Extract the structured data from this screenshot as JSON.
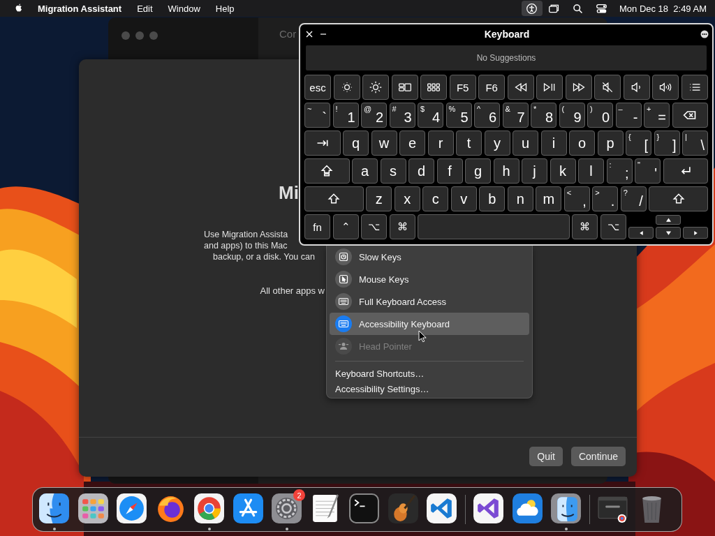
{
  "menu_bar": {
    "app": "Migration Assistant",
    "menus": [
      "Edit",
      "Window",
      "Help"
    ],
    "clock": "Mon Dec 18  2:49 AM"
  },
  "background_window": {
    "title": "Cor"
  },
  "migration_window": {
    "title": "Mi",
    "lines": [
      "Use Migration Assista",
      "and apps) to this Mac",
      "backup, or a disk. You can"
    ],
    "note": "All other apps w",
    "buttons": [
      "Quit",
      "Continue"
    ]
  },
  "keyboard_window": {
    "title": "Keyboard",
    "suggestion": "No Suggestions",
    "rows": [
      {
        "keys": [
          {
            "kind": "char",
            "label": "esc"
          },
          {
            "kind": "icon"
          },
          {
            "kind": "icon"
          },
          {
            "kind": "icon"
          },
          {
            "kind": "icon"
          },
          {
            "kind": "char",
            "label": "F5"
          },
          {
            "kind": "char",
            "label": "F6"
          },
          {
            "kind": "icon"
          },
          {
            "kind": "icon"
          },
          {
            "kind": "icon"
          },
          {
            "kind": "icon"
          },
          {
            "kind": "icon"
          },
          {
            "kind": "icon"
          },
          {
            "kind": "icon"
          }
        ]
      },
      {
        "keys": [
          {
            "kind": "dual",
            "top": "~",
            "label": "`"
          },
          {
            "kind": "dual",
            "top": "!",
            "label": "1"
          },
          {
            "kind": "dual",
            "top": "@",
            "label": "2"
          },
          {
            "kind": "dual",
            "top": "#",
            "label": "3"
          },
          {
            "kind": "dual",
            "top": "$",
            "label": "4"
          },
          {
            "kind": "dual",
            "top": "%",
            "label": "5"
          },
          {
            "kind": "dual",
            "top": "^",
            "label": "6"
          },
          {
            "kind": "dual",
            "top": "&",
            "label": "7"
          },
          {
            "kind": "dual",
            "top": "*",
            "label": "8"
          },
          {
            "kind": "dual",
            "top": "(",
            "label": "9"
          },
          {
            "kind": "dual",
            "top": ")",
            "label": "0"
          },
          {
            "kind": "dual",
            "top": "–",
            "label": "-"
          },
          {
            "kind": "dual",
            "top": "+",
            "label": "="
          },
          {
            "kind": "icon"
          }
        ]
      },
      {
        "keys": [
          {
            "kind": "icon"
          },
          {
            "kind": "char",
            "label": "q"
          },
          {
            "kind": "char",
            "label": "w"
          },
          {
            "kind": "char",
            "label": "e"
          },
          {
            "kind": "char",
            "label": "r"
          },
          {
            "kind": "char",
            "label": "t"
          },
          {
            "kind": "char",
            "label": "y"
          },
          {
            "kind": "char",
            "label": "u"
          },
          {
            "kind": "char",
            "label": "i"
          },
          {
            "kind": "char",
            "label": "o"
          },
          {
            "kind": "char",
            "label": "p"
          },
          {
            "kind": "dual",
            "top": "{",
            "label": "["
          },
          {
            "kind": "dual",
            "top": "}",
            "label": "]"
          },
          {
            "kind": "dual",
            "top": "|",
            "label": "\\"
          }
        ]
      },
      {
        "keys": [
          {
            "kind": "icon"
          },
          {
            "kind": "char",
            "label": "a"
          },
          {
            "kind": "char",
            "label": "s"
          },
          {
            "kind": "char",
            "label": "d"
          },
          {
            "kind": "char",
            "label": "f"
          },
          {
            "kind": "char",
            "label": "g"
          },
          {
            "kind": "char",
            "label": "h"
          },
          {
            "kind": "char",
            "label": "j"
          },
          {
            "kind": "char",
            "label": "k"
          },
          {
            "kind": "char",
            "label": "l"
          },
          {
            "kind": "dual",
            "top": ":",
            "label": ";"
          },
          {
            "kind": "dual",
            "top": "\"",
            "label": "'"
          },
          {
            "kind": "icon"
          }
        ]
      },
      {
        "keys": [
          {
            "kind": "icon"
          },
          {
            "kind": "char",
            "label": "z"
          },
          {
            "kind": "char",
            "label": "x"
          },
          {
            "kind": "char",
            "label": "c"
          },
          {
            "kind": "char",
            "label": "v"
          },
          {
            "kind": "char",
            "label": "b"
          },
          {
            "kind": "char",
            "label": "n"
          },
          {
            "kind": "char",
            "label": "m"
          },
          {
            "kind": "dual",
            "top": "<",
            "label": ","
          },
          {
            "kind": "dual",
            "top": ">",
            "label": "."
          },
          {
            "kind": "dual",
            "top": "?",
            "label": "/"
          },
          {
            "kind": "icon"
          }
        ]
      },
      {
        "keys": [
          {
            "kind": "char",
            "label": "fn"
          },
          {
            "kind": "char",
            "label": "⌃"
          },
          {
            "kind": "char",
            "label": "⌥"
          },
          {
            "kind": "char",
            "label": "⌘"
          },
          {
            "kind": "space"
          },
          {
            "kind": "char",
            "label": "⌘"
          },
          {
            "kind": "char",
            "label": "⌥"
          },
          {
            "kind": "arrows"
          }
        ]
      }
    ]
  },
  "popup_menu": {
    "items": [
      {
        "label": "Slow Keys",
        "selected": false,
        "disabled": false
      },
      {
        "label": "Mouse Keys",
        "selected": false,
        "disabled": false
      },
      {
        "label": "Full Keyboard Access",
        "selected": false,
        "disabled": false
      },
      {
        "label": "Accessibility Keyboard",
        "selected": true,
        "disabled": false
      },
      {
        "label": "Head Pointer",
        "selected": false,
        "disabled": true
      }
    ],
    "actions": [
      "Keyboard Shortcuts…",
      "Accessibility Settings…"
    ]
  },
  "dock": [
    {
      "kind": "app",
      "running": true
    },
    {
      "kind": "app",
      "running": false
    },
    {
      "kind": "app",
      "running": false
    },
    {
      "kind": "app",
      "running": false
    },
    {
      "kind": "app",
      "running": true
    },
    {
      "kind": "app",
      "running": false
    },
    {
      "kind": "app",
      "running": true,
      "badge": "2"
    },
    {
      "kind": "app",
      "running": false
    },
    {
      "kind": "app",
      "running": false
    },
    {
      "kind": "app",
      "running": false
    },
    {
      "kind": "app",
      "running": false
    },
    {
      "kind": "separator"
    },
    {
      "kind": "app",
      "running": false
    },
    {
      "kind": "app",
      "running": false
    },
    {
      "kind": "app",
      "running": true
    },
    {
      "kind": "separator"
    },
    {
      "kind": "app",
      "running": false
    },
    {
      "kind": "app",
      "running": false
    }
  ]
}
